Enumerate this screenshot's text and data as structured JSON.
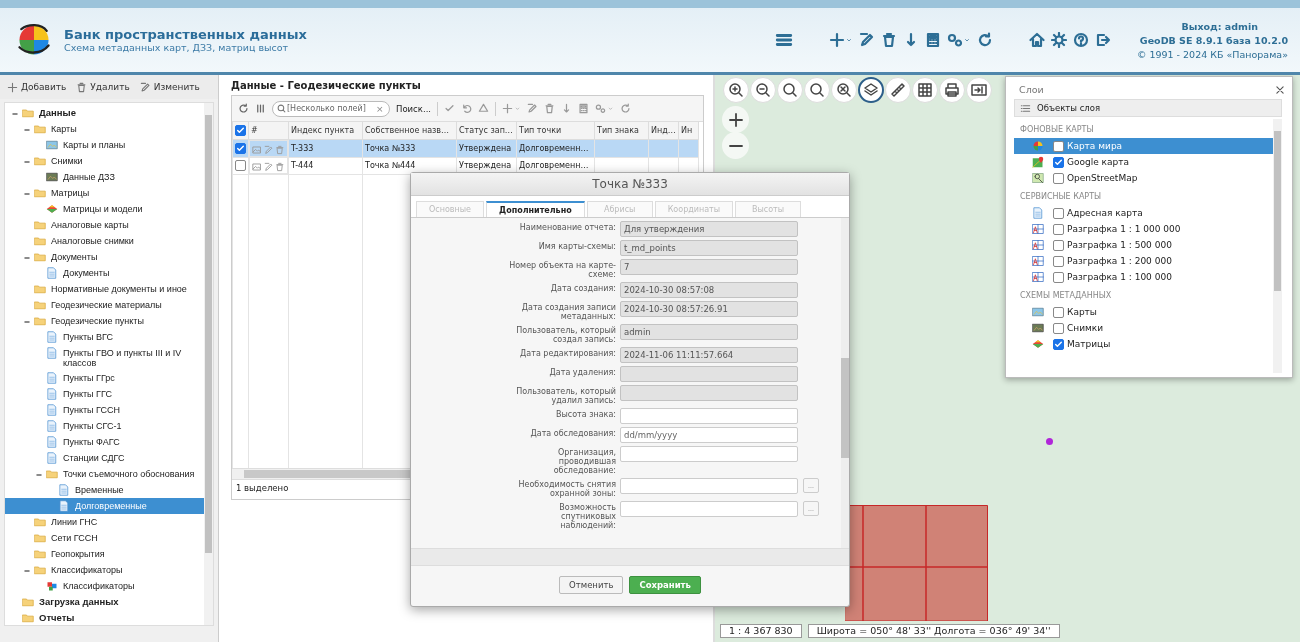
{
  "header": {
    "title": "Банк пространственных данных",
    "subtitle": "Схема метаданных карт, ДЗЗ, матриц высот",
    "logout": "Выход: admin",
    "version": "GeoDB SE 8.9.1 база 10.2.0",
    "copyright": "© 1991 - 2024 КБ «Панорама»"
  },
  "tree_toolbar": [
    {
      "label": "Добавить"
    },
    {
      "label": "Удалить"
    },
    {
      "label": "Изменить"
    }
  ],
  "tree": [
    {
      "label": "Данные",
      "kind": "folder",
      "selected": false,
      "expanded": true,
      "children": [
        {
          "label": "Карты",
          "kind": "folder",
          "selected": false,
          "expanded": true,
          "children": [
            {
              "label": "Карты и планы",
              "kind": "maps",
              "selected": false
            }
          ]
        },
        {
          "label": "Снимки",
          "kind": "folder",
          "selected": false,
          "expanded": true,
          "children": [
            {
              "label": "Данные ДЗЗ",
              "kind": "images",
              "selected": false
            }
          ]
        },
        {
          "label": "Матрицы",
          "kind": "folder",
          "selected": false,
          "expanded": true,
          "children": [
            {
              "label": "Матрицы и модели",
              "kind": "matrix",
              "selected": false
            }
          ]
        },
        {
          "label": "Аналоговые карты",
          "kind": "folder",
          "selected": false
        },
        {
          "label": "Аналоговые снимки",
          "kind": "folder",
          "selected": false
        },
        {
          "label": "Документы",
          "kind": "folder",
          "selected": false,
          "expanded": true,
          "children": [
            {
              "label": "Документы",
              "kind": "doc",
              "selected": false
            }
          ]
        },
        {
          "label": "Нормативные документы и иное",
          "kind": "folder",
          "selected": false
        },
        {
          "label": "Геодезические материалы",
          "kind": "folder",
          "selected": false
        },
        {
          "label": "Геодезические пункты",
          "kind": "folder",
          "selected": false,
          "expanded": true,
          "children": [
            {
              "label": "Пункты ВГС",
              "kind": "doc",
              "selected": false
            },
            {
              "label": "Пункты ГВО и пункты III и IV классов",
              "kind": "doc",
              "selected": false
            },
            {
              "label": "Пункты ГГрс",
              "kind": "doc",
              "selected": false
            },
            {
              "label": "Пункты ГГС",
              "kind": "doc",
              "selected": false
            },
            {
              "label": "Пункты ГССН",
              "kind": "doc",
              "selected": false
            },
            {
              "label": "Пункты СГС-1",
              "kind": "doc",
              "selected": false
            },
            {
              "label": "Пункты ФАГС",
              "kind": "doc",
              "selected": false
            },
            {
              "label": "Станции СДГС",
              "kind": "doc",
              "selected": false
            },
            {
              "label": "Точки съемочного обоснования",
              "kind": "folder",
              "selected": false,
              "expanded": true,
              "children": [
                {
                  "label": "Временные",
                  "kind": "doc",
                  "selected": false
                },
                {
                  "label": "Долговременные",
                  "kind": "doc",
                  "selected": true
                }
              ]
            }
          ]
        },
        {
          "label": "Линии ГНС",
          "kind": "folder",
          "selected": false
        },
        {
          "label": "Сети ГССН",
          "kind": "folder",
          "selected": false
        },
        {
          "label": "Геопокрытия",
          "kind": "folder",
          "selected": false
        },
        {
          "label": "Классификаторы",
          "kind": "folder",
          "selected": false,
          "expanded": true,
          "children": [
            {
              "label": "Классификаторы",
              "kind": "classifier",
              "selected": false
            }
          ]
        }
      ]
    },
    {
      "label": "Загрузка данных",
      "kind": "folder",
      "selected": false
    },
    {
      "label": "Отчеты",
      "kind": "folder",
      "selected": false
    }
  ],
  "grid": {
    "title": "Данные - Геодезические пункты",
    "search": {
      "placeholder": "[Несколько полей]",
      "clear": "×"
    },
    "search_button": "Поиск...",
    "columns": [
      "#",
      "Индекс пункта",
      "Собственное назв…",
      "Статус зап…",
      "Тип точки",
      "Тип знака",
      "Инд…",
      "Ин"
    ],
    "all_checked": true,
    "rows": [
      {
        "checked": true,
        "selected": true,
        "cells": [
          "",
          "T-333",
          "Точка №333",
          "Утверждена",
          "Долговременн…"
        ]
      },
      {
        "checked": false,
        "selected": false,
        "cells": [
          "",
          "T-444",
          "Точка №444",
          "Утверждена",
          "Долговременн…"
        ]
      }
    ],
    "footer": "1 выделено"
  },
  "dialog": {
    "title": "Точка №333",
    "tabs": [
      {
        "label": "Основные",
        "selected": false
      },
      {
        "label": "Дополнительно",
        "selected": true
      },
      {
        "label": "Абрисы",
        "selected": false
      },
      {
        "label": "Координаты",
        "selected": false
      },
      {
        "label": "Высоты",
        "selected": false
      }
    ],
    "fields": [
      {
        "label": "Наименование отчета:",
        "value": "Для утверждения",
        "readonly": true
      },
      {
        "label": "Имя карты-схемы:",
        "value": "t_md_points",
        "readonly": true
      },
      {
        "label": "Номер объекта на карте-схеме:",
        "value": "7",
        "readonly": true
      },
      {
        "label": "Дата создания:",
        "value": "2024-10-30 08:57:08",
        "readonly": true
      },
      {
        "label": "Дата создания записи метаданных:",
        "value": "2024-10-30 08:57:26.91",
        "readonly": true
      },
      {
        "label": "Пользователь, который создал запись:",
        "value": "admin",
        "readonly": true
      },
      {
        "label": "Дата редактирования:",
        "value": "2024-11-06 11:11:57.664",
        "readonly": true
      },
      {
        "label": "Дата удаления:",
        "readonly": true
      },
      {
        "label": "Пользователь, который удалил запись:",
        "readonly": true
      },
      {
        "label": "Высота знака:",
        "readonly": false
      },
      {
        "label": "Дата обследования:",
        "placeholder": "dd/mm/yyyy",
        "readonly": false
      },
      {
        "label": "Организация, проводившая обследование:",
        "readonly": false
      },
      {
        "label": "Необходимость снятия охранной зоны:",
        "readonly": false,
        "picker": "..."
      },
      {
        "label": "Возможность спутниковых наблюдений:",
        "readonly": false,
        "picker": "..."
      }
    ],
    "buttons": [
      {
        "label": "Отменить",
        "kind": "secondary"
      },
      {
        "label": "Сохранить",
        "kind": "primary"
      }
    ]
  },
  "map_tools": [
    {
      "selected": false
    },
    {
      "selected": false
    },
    {
      "selected": false
    },
    {
      "selected": false
    },
    {
      "selected": false
    },
    {
      "selected": true
    },
    {
      "selected": false
    },
    {
      "selected": false
    },
    {
      "selected": false
    },
    {
      "selected": false
    }
  ],
  "layers": {
    "title": "Слои",
    "objects_button": "Объекты слоя",
    "groups": [
      {
        "title": "ФОНОВЫЕ КАРТЫ",
        "items": [
          {
            "label": "Карта мира",
            "kind": "world",
            "checked": false,
            "selected": true
          },
          {
            "label": "Google карта",
            "kind": "google",
            "checked": true,
            "selected": false
          },
          {
            "label": "OpenStreetMap",
            "kind": "osm",
            "checked": false,
            "selected": false
          }
        ]
      },
      {
        "title": "СЕРВИСНЫЕ КАРТЫ",
        "items": [
          {
            "label": "Адресная карта",
            "kind": "doc",
            "checked": false,
            "selected": false
          },
          {
            "label": "Разграфка 1 : 1 000 000",
            "kind": "grid",
            "checked": false,
            "selected": false
          },
          {
            "label": "Разграфка 1 : 500 000",
            "kind": "grid",
            "checked": false,
            "selected": false
          },
          {
            "label": "Разграфка 1 : 200 000",
            "kind": "grid",
            "checked": false,
            "selected": false
          },
          {
            "label": "Разграфка 1 : 100 000",
            "kind": "grid",
            "checked": false,
            "selected": false
          }
        ]
      },
      {
        "title": "СХЕМЫ МЕТАДАННЫХ",
        "items": [
          {
            "label": "Карты",
            "kind": "maps",
            "checked": false,
            "selected": false
          },
          {
            "label": "Снимки",
            "kind": "images",
            "checked": false,
            "selected": false
          },
          {
            "label": "Матрицы",
            "kind": "matrix",
            "checked": true,
            "selected": false
          }
        ]
      }
    ]
  },
  "status": {
    "scale": "1 : 4 367 830",
    "coords": "Широта = 050° 48' 33'' Долгота = 036° 49' 34''"
  }
}
